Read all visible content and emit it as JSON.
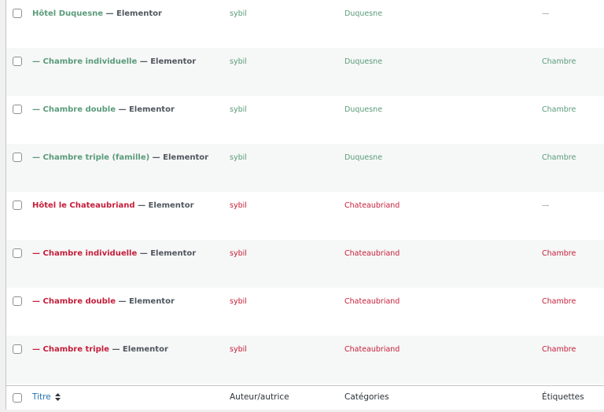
{
  "colors": {
    "green": "#5a9b7a",
    "red": "#c41e3a",
    "dash": "#8c8f94"
  },
  "rows": [
    {
      "title": "Hôtel Duquesne",
      "suffix": " — Elementor",
      "author": "sybil",
      "category": "Duquesne",
      "tags": "—",
      "tone": "green"
    },
    {
      "title": "— Chambre individuelle",
      "suffix": " — Elementor",
      "author": "sybil",
      "category": "Duquesne",
      "tags": "Chambre",
      "tone": "green"
    },
    {
      "title": "— Chambre double",
      "suffix": " — Elementor",
      "author": "sybil",
      "category": "Duquesne",
      "tags": "Chambre",
      "tone": "green"
    },
    {
      "title": "— Chambre triple (famille)",
      "suffix": " — Elementor",
      "author": "sybil",
      "category": "Duquesne",
      "tags": "Chambre",
      "tone": "green"
    },
    {
      "title": "Hôtel le Chateaubriand",
      "suffix": " — Elementor",
      "author": "sybil",
      "category": "Chateaubriand",
      "tags": "—",
      "tone": "red"
    },
    {
      "title": "— Chambre individuelle",
      "suffix": " — Elementor",
      "author": "sybil",
      "category": "Chateaubriand",
      "tags": "Chambre",
      "tone": "red"
    },
    {
      "title": "— Chambre double",
      "suffix": " — Elementor",
      "author": "sybil",
      "category": "Chateaubriand",
      "tags": "Chambre",
      "tone": "red"
    },
    {
      "title": "— Chambre triple",
      "suffix": " — Elementor",
      "author": "sybil",
      "category": "Chateaubriand",
      "tags": "Chambre",
      "tone": "red"
    }
  ],
  "footer": {
    "title": "Titre",
    "sort_icon": "sort-arrows-icon",
    "author": "Auteur/autrice",
    "categories": "Catégories",
    "tags": "Étiquettes"
  }
}
